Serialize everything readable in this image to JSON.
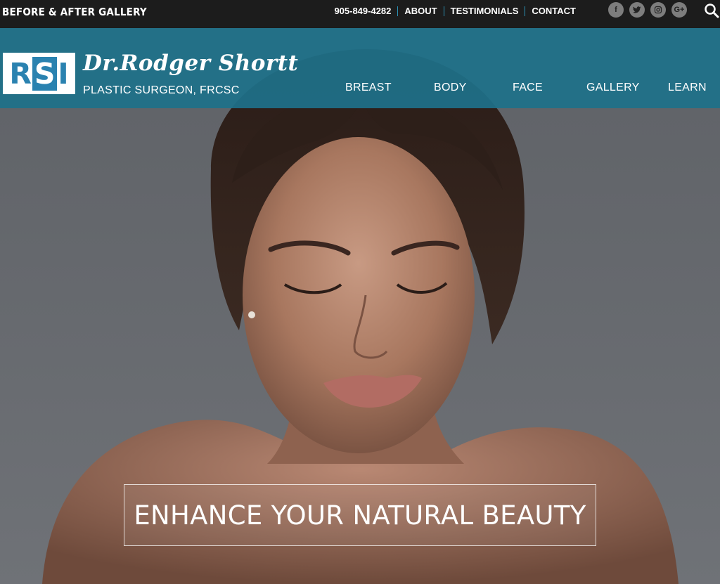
{
  "topbar": {
    "gallery_link": "BEFORE & AFTER GALLERY",
    "phone": "905-849-4282",
    "links": [
      "ABOUT",
      "TESTIMONIALS",
      "CONTACT"
    ],
    "social": {
      "facebook": "f",
      "twitter": "t",
      "instagram": "◎",
      "google_plus": "G+"
    }
  },
  "brand": {
    "logo_letters": [
      "R",
      "S",
      "I"
    ],
    "name": "Dr.Rodger Shortt",
    "subtitle": "PLASTIC SURGEON, FRCSC",
    "accent_color": "#2a82b0"
  },
  "nav": {
    "items": [
      "BREAST",
      "BODY",
      "FACE",
      "GALLERY",
      "LEARN"
    ]
  },
  "hero": {
    "tagline": "ENHANCE YOUR NATURAL BEAUTY"
  },
  "colors": {
    "topbar_bg": "#1c1c1c",
    "header_bg": "#1e718a",
    "separator": "#2b8fb3"
  }
}
